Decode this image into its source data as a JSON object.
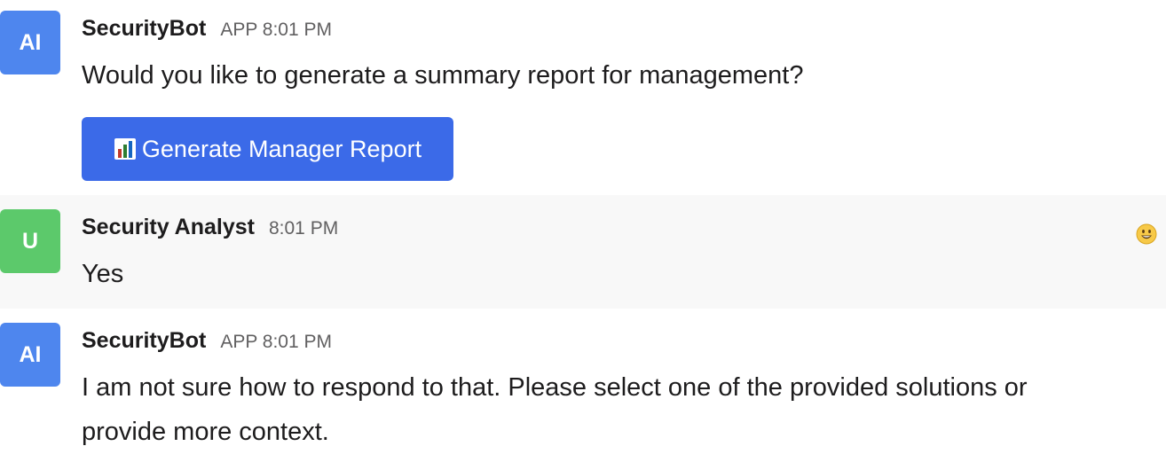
{
  "messages": [
    {
      "avatar": "AI",
      "sender": "SecurityBot",
      "meta": "APP 8:01 PM",
      "text": "Would you like to generate a summary report for management?",
      "button": {
        "label": "Generate Manager Report",
        "icon": "bar-chart-icon"
      }
    },
    {
      "avatar": "U",
      "sender": "Security Analyst",
      "meta": "8:01 PM",
      "text": "Yes",
      "reaction_icon": "grinning-face-emoji-icon"
    },
    {
      "avatar": "AI",
      "sender": "SecurityBot",
      "meta": "APP 8:01 PM",
      "text_line1": "I am not sure how to respond to that. Please select one of the provided solutions or",
      "text_line2": "provide more context."
    }
  ],
  "colors": {
    "bot_avatar": "#4e86ee",
    "user_avatar": "#5cc96b",
    "button": "#3b6ae8",
    "hover_row": "#f8f8f8"
  }
}
